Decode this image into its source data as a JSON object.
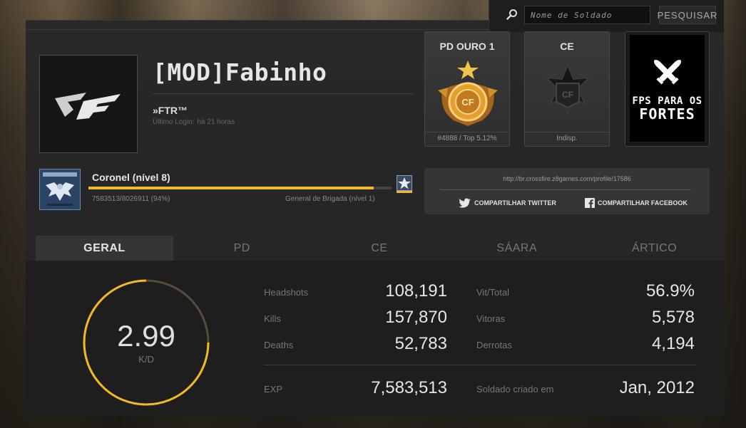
{
  "search": {
    "placeholder": "Nome de Soldado",
    "button_label": "PESQUISAR"
  },
  "profile": {
    "name": "[MOD]Fabinho",
    "clan": "»FTR™",
    "last_login_label": "Último Login:",
    "last_login_value": "há 21 horas"
  },
  "rank_cards": [
    {
      "title": "PD OURO 1",
      "footer": "#4888 / Top 5.12%"
    },
    {
      "title": "CE",
      "footer": "Indisp."
    }
  ],
  "promo": {
    "line1": "FPS PARA OS",
    "line2": "FORTES"
  },
  "level": {
    "name": "Coronel (nível 8)",
    "xp_text": "7583513/8026911 (94%)",
    "progress_fraction": 0.94,
    "next_level": "General de Brigada (nível 1)"
  },
  "share": {
    "url": "http://br.crossfire.z8games.com/profile/17586",
    "twitter_label": "COMPARTILHAR TWITTER",
    "facebook_label": "COMPARTILHAR FACEBOOK"
  },
  "tabs": [
    {
      "label": "GERAL",
      "active": true
    },
    {
      "label": "PD",
      "active": false
    },
    {
      "label": "CE",
      "active": false
    },
    {
      "label": "SÁARA",
      "active": false
    },
    {
      "label": "ÁRTICO",
      "active": false
    }
  ],
  "kd": {
    "value": "2.99",
    "label": "K/D",
    "ring_fraction": 0.75
  },
  "stats": {
    "headshots_label": "Headshots",
    "headshots": "108,191",
    "kills_label": "Kills",
    "kills": "157,870",
    "deaths_label": "Deaths",
    "deaths": "52,783",
    "exp_label": "EXP",
    "exp": "7,583,513",
    "win_ratio_label": "Vit/Total",
    "win_ratio": "56.9%",
    "wins_label": "Vitoras",
    "wins": "5,578",
    "losses_label": "Derrotas",
    "losses": "4,194",
    "created_label": "Soldado criado em",
    "created": "Jan, 2012"
  },
  "colors": {
    "accent": "#f3b728",
    "panel": "#282828",
    "tab_active": "#353535"
  }
}
